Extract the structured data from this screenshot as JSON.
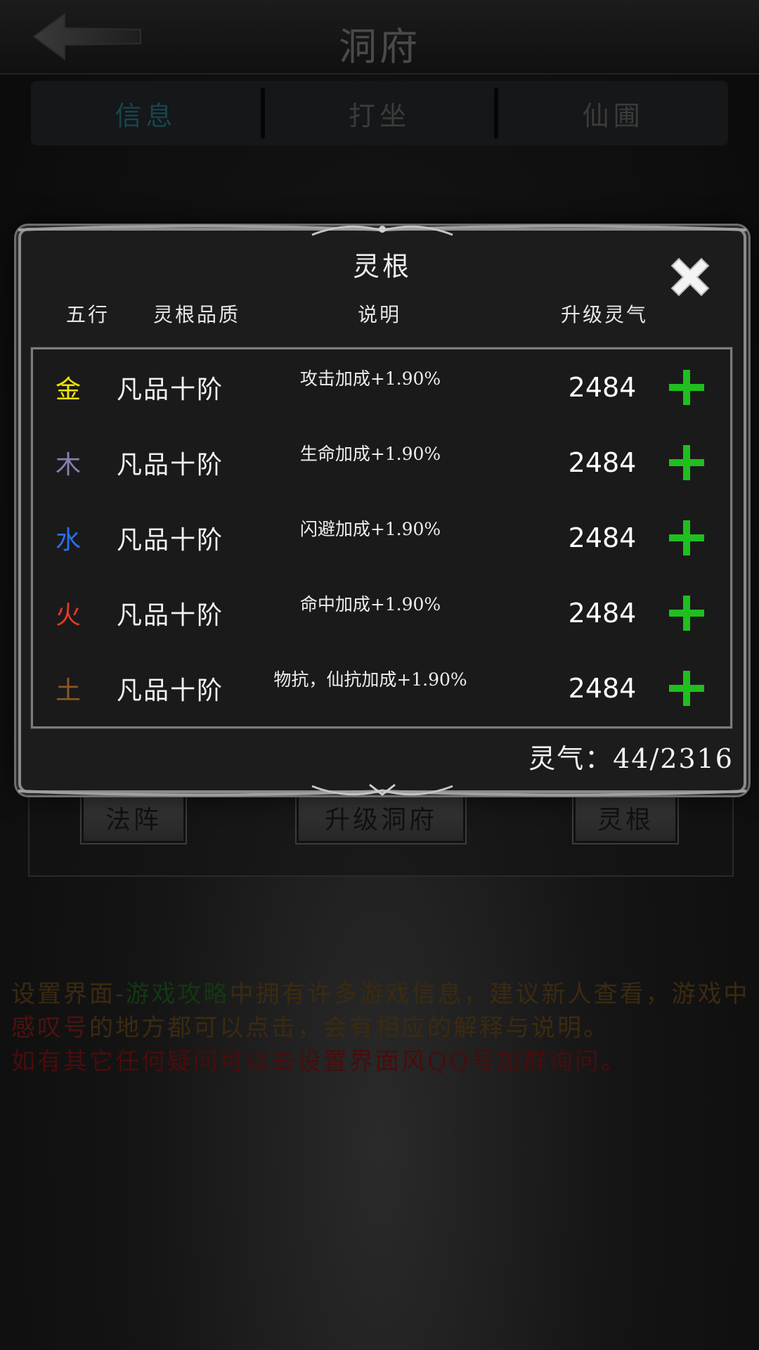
{
  "header": {
    "title": "洞府",
    "back_icon": "arrow-left-icon"
  },
  "tabs": [
    {
      "label": "信息",
      "active": true
    },
    {
      "label": "打坐",
      "active": false
    },
    {
      "label": "仙圃",
      "active": false
    }
  ],
  "underlying_buttons": {
    "formation": "法阵",
    "upgrade": "升级洞府",
    "spirit_root": "灵根"
  },
  "tip": {
    "segments": [
      {
        "text": "设置界面-",
        "color": "#3b2a10"
      },
      {
        "text": "游戏攻略",
        "color": "#123812"
      },
      {
        "text": "中拥有许多游戏信息，建议新人查看，游戏中",
        "color": "#3b2a10"
      },
      {
        "text": "感叹号",
        "color": "#4d1212"
      },
      {
        "text": "的地方都可以点击，会有相应的解释与说明。",
        "color": "#3b2a10"
      },
      {
        "text": "如有其它任何疑问可以去设置界面风QQ号加群询问。",
        "color": "#4a0c0c"
      }
    ]
  },
  "dialog": {
    "title": "灵根",
    "close_icon": "close-x-icon",
    "columns": [
      "五行",
      "灵根品质",
      "说明",
      "升级灵气"
    ],
    "rows": [
      {
        "element": "金",
        "color": "#f5e400",
        "quality": "凡品十阶",
        "description": "攻击加成+1.90%",
        "cost": "2484",
        "icon": "plus-icon"
      },
      {
        "element": "木",
        "color": "#8a7fb0",
        "quality": "凡品十阶",
        "description": "生命加成+1.90%",
        "cost": "2484",
        "icon": "plus-icon"
      },
      {
        "element": "水",
        "color": "#2a6fe8",
        "quality": "凡品十阶",
        "description": "闪避加成+1.90%",
        "cost": "2484",
        "icon": "plus-icon"
      },
      {
        "element": "火",
        "color": "#e03a2a",
        "quality": "凡品十阶",
        "description": "命中加成+1.90%",
        "cost": "2484",
        "icon": "plus-icon"
      },
      {
        "element": "土",
        "color": "#8a5a22",
        "quality": "凡品十阶",
        "description": "物抗，仙抗加成+1.90%",
        "cost": "2484",
        "icon": "plus-icon"
      }
    ],
    "lingqi": "灵气：44/2316",
    "plus_color": "#1fbf1f"
  }
}
